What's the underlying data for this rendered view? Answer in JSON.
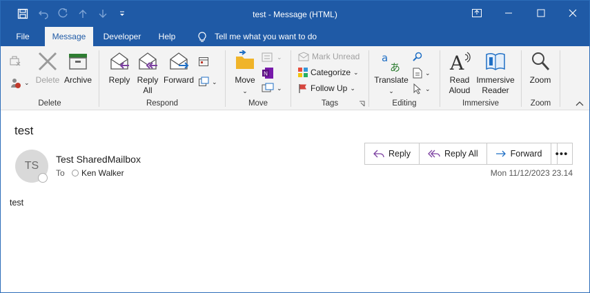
{
  "window": {
    "title": "test  -  Message (HTML)"
  },
  "tabs": [
    "File",
    "Message",
    "Developer",
    "Help"
  ],
  "tell_me": "Tell me what you want to do",
  "ribbon": {
    "delete": {
      "delete": "Delete",
      "archive": "Archive",
      "group": "Delete"
    },
    "respond": {
      "reply": "Reply",
      "reply_all_1": "Reply",
      "reply_all_2": "All",
      "forward": "Forward",
      "group": "Respond"
    },
    "move": {
      "move": "Move",
      "group": "Move"
    },
    "tags": {
      "mark_unread": "Mark Unread",
      "categorize": "Categorize",
      "follow_up": "Follow Up",
      "group": "Tags"
    },
    "editing": {
      "translate": "Translate",
      "group": "Editing"
    },
    "immersive": {
      "read_1": "Read",
      "read_2": "Aloud",
      "imm_1": "Immersive",
      "imm_2": "Reader",
      "group": "Immersive"
    },
    "zoom": {
      "zoom": "Zoom",
      "group": "Zoom"
    }
  },
  "message": {
    "subject": "test",
    "avatar": "TS",
    "sender": "Test SharedMailbox",
    "to_label": "To",
    "recipient": "Ken Walker",
    "date": "Mon 11/12/2023 23.14",
    "body": "test",
    "actions": {
      "reply": "Reply",
      "reply_all": "Reply All",
      "forward": "Forward"
    }
  }
}
